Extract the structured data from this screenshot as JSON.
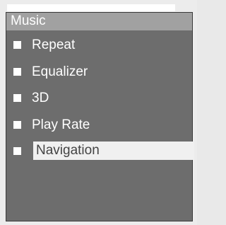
{
  "panel": {
    "title": "Music",
    "items": [
      {
        "label": "Repeat",
        "icon": "square-bullet-icon",
        "selected": false
      },
      {
        "label": "Equalizer",
        "icon": "square-bullet-icon",
        "selected": false
      },
      {
        "label": "3D",
        "icon": "square-bullet-icon",
        "selected": false
      },
      {
        "label": "Play Rate",
        "icon": "square-bullet-icon",
        "selected": false
      },
      {
        "label": "Navigation",
        "icon": "square-bullet-icon",
        "selected": true
      }
    ]
  },
  "colors": {
    "panel_background": "#6d6d6d",
    "title_bar": "#a1a1a1",
    "text": "#ffffff",
    "selection_background": "#f0f0f0",
    "selected_text": "#444444"
  }
}
